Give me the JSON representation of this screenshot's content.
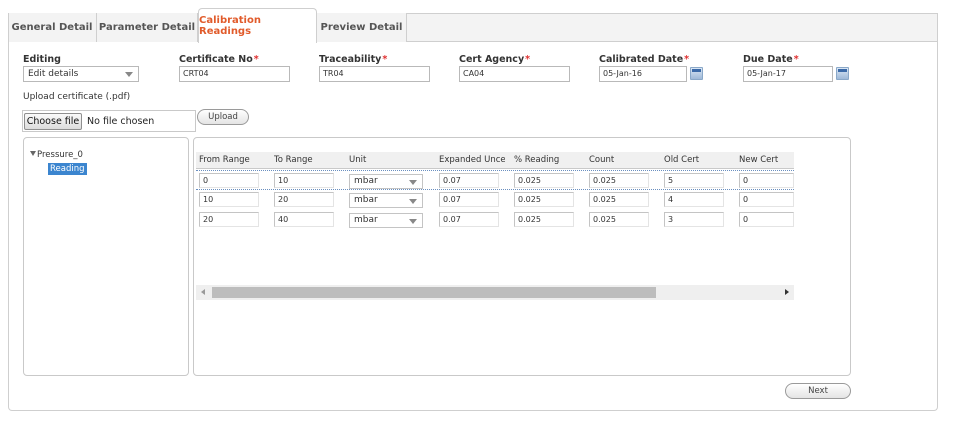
{
  "tabs": [
    {
      "label": "General Detail",
      "active": false
    },
    {
      "label": "Parameter Detail",
      "active": false
    },
    {
      "label": "Calibration Readings",
      "active": true
    },
    {
      "label": "Preview Detail",
      "active": false
    }
  ],
  "form": {
    "editing": {
      "label": "Editing",
      "value": "Edit details"
    },
    "certificate_no": {
      "label": "Certificate No",
      "required": "*",
      "value": "CRT04"
    },
    "traceability": {
      "label": "Traceability",
      "required": "*",
      "value": "TR04"
    },
    "cert_agency": {
      "label": "Cert Agency",
      "required": "*",
      "value": "CA04"
    },
    "calibrated_date": {
      "label": "Calibrated Date",
      "required": "*",
      "value": "05-Jan-16"
    },
    "due_date": {
      "label": "Due Date",
      "required": "*",
      "value": "05-Jan-17"
    }
  },
  "upload": {
    "label": "Upload certificate (.pdf)",
    "choose_label": "Choose file",
    "status": "No file chosen",
    "button_label": "Upload"
  },
  "tree": {
    "root": "Pressure_0",
    "selected": "Reading"
  },
  "grid": {
    "columns": [
      "From Range",
      "To Range",
      "Unit",
      "Expanded Uncer",
      "% Reading",
      "Count",
      "Old Cert",
      "New Cert"
    ],
    "rows": [
      [
        "0",
        "10",
        "mbar",
        "0.07",
        "0.025",
        "0.025",
        "5",
        "0"
      ],
      [
        "10",
        "20",
        "mbar",
        "0.07",
        "0.025",
        "0.025",
        "4",
        "0"
      ],
      [
        "20",
        "40",
        "mbar",
        "0.07",
        "0.025",
        "0.025",
        "3",
        "0"
      ]
    ]
  },
  "next_label": "Next",
  "colors": {
    "active_tab": "#e15b2b",
    "required": "#e03030",
    "selection": "#3b85cf"
  }
}
